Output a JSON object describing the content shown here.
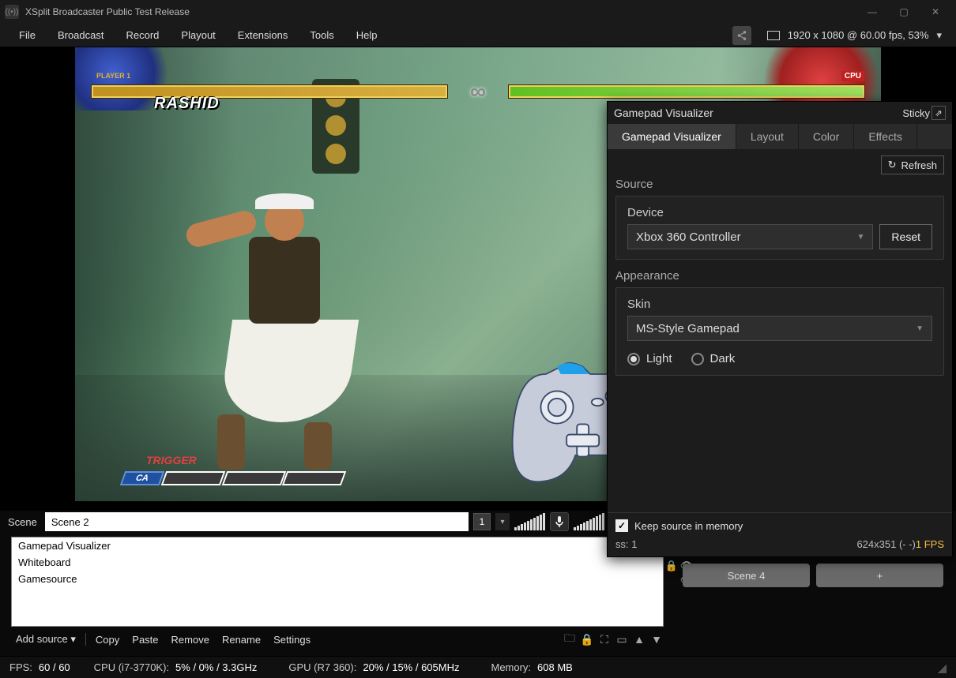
{
  "window": {
    "title": "XSplit Broadcaster Public Test Release"
  },
  "menu": {
    "file": "File",
    "broadcast": "Broadcast",
    "record": "Record",
    "playout": "Playout",
    "extensions": "Extensions",
    "tools": "Tools",
    "help": "Help",
    "resolution_info": "1920 x 1080 @ 60.00 fps, 53%"
  },
  "preview": {
    "player1_tag": "PLAYER 1",
    "cpu_tag": "CPU",
    "char_name": "RASHID",
    "trigger_label": "TRIGGER",
    "ca_label": "CA",
    "infinity": "∞"
  },
  "scene": {
    "label": "Scene",
    "name": "Scene 2",
    "number": "1"
  },
  "sources": {
    "items": [
      "Gamepad Visualizer",
      "Whiteboard",
      "Gamesource"
    ]
  },
  "toolbar": {
    "add_source": "Add source",
    "copy": "Copy",
    "paste": "Paste",
    "remove": "Remove",
    "rename": "Rename",
    "settings": "Settings"
  },
  "right_scenes": {
    "scene4": "Scene 4",
    "plus": "+"
  },
  "status": {
    "fps_label": "FPS:",
    "fps_value": "60 / 60",
    "cpu_label": "CPU (i7-3770K):",
    "cpu_value": "5% / 0% / 3.3GHz",
    "gpu_label": "GPU (R7 360):",
    "gpu_value": "20% / 15% / 605MHz",
    "mem_label": "Memory:",
    "mem_value": "608 MB"
  },
  "panel": {
    "title": "Gamepad Visualizer",
    "sticky": "Sticky",
    "tabs": {
      "visualizer": "Gamepad Visualizer",
      "layout": "Layout",
      "color": "Color",
      "effects": "Effects"
    },
    "refresh": "Refresh",
    "source_section": "Source",
    "device_label": "Device",
    "device_value": "Xbox 360 Controller",
    "reset": "Reset",
    "appearance_section": "Appearance",
    "skin_label": "Skin",
    "skin_value": "MS-Style Gamepad",
    "theme_light": "Light",
    "theme_dark": "Dark",
    "keep_memory": "Keep source in memory",
    "info_ss": "ss: 1",
    "info_dim": "624x351 (- -) ",
    "info_fps": "1 FPS"
  }
}
